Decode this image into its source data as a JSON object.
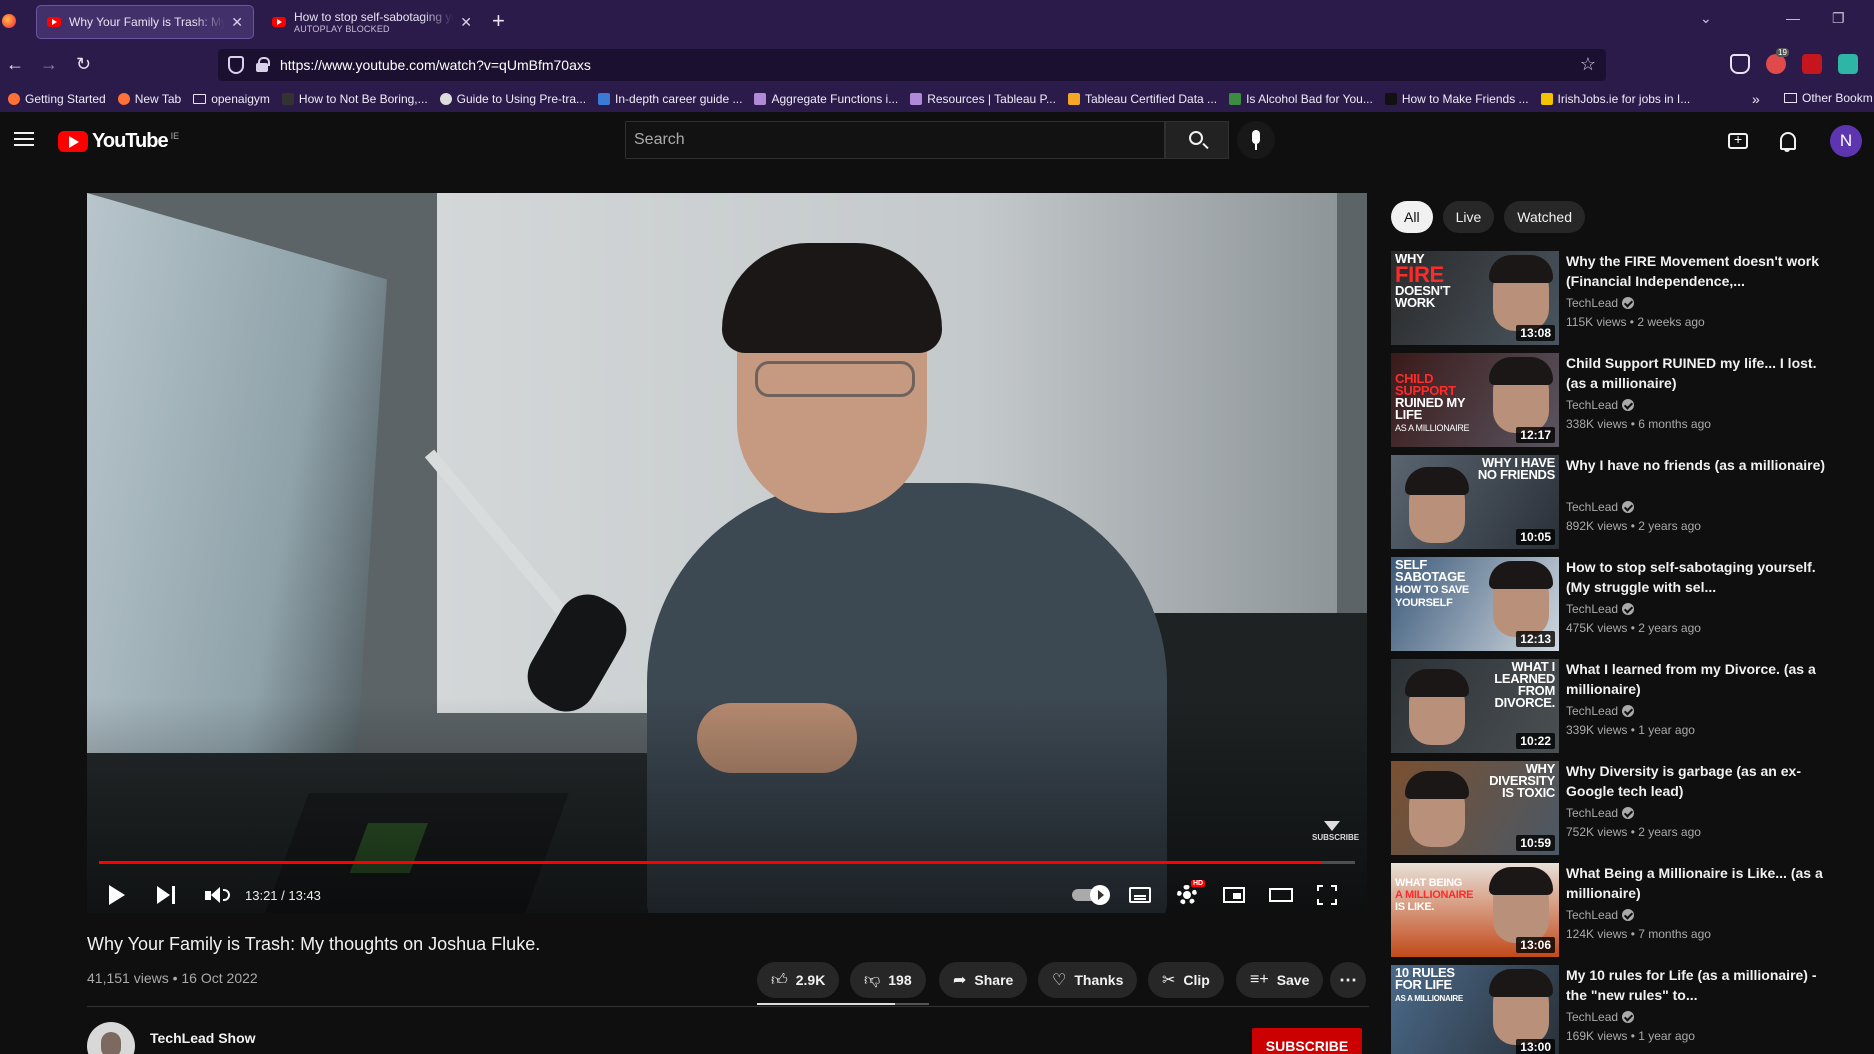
{
  "browser": {
    "tabs": [
      {
        "title": "Why Your Family is Trash: My th",
        "active": true
      },
      {
        "title": "How to stop self-sabotaging yo",
        "subtitle": "AUTOPLAY BLOCKED",
        "active": false
      }
    ],
    "url": "https://www.youtube.com/watch?v=qUmBfm70axs",
    "ext_badge": "19",
    "bookmarks": [
      "Getting Started",
      "New Tab",
      "openaigym",
      "How to Not Be Boring,...",
      "Guide to Using Pre-tra...",
      "In-depth career guide ...",
      "Aggregate Functions i...",
      "Resources | Tableau P...",
      "Tableau Certified Data ...",
      "Is Alcohol Bad for You...",
      "How to Make Friends ...",
      "IrishJobs.ie for jobs in I..."
    ],
    "bookmarks_more": "»",
    "other_bookmarks": "Other Bookm"
  },
  "youtube": {
    "logo_text": "YouTube",
    "country_code": "IE",
    "search_placeholder": "Search",
    "avatar_letter": "N"
  },
  "player": {
    "time": "13:21 / 13:43",
    "progress": 0.973,
    "watermark": "SUBSCRIBE",
    "hd_badge": "HD"
  },
  "video": {
    "title": "Why Your Family is Trash: My thoughts on Joshua Fluke.",
    "meta": "41,151 views • 16 Oct 2022",
    "likes": "2.9K",
    "dislikes": "198",
    "share": "Share",
    "thanks": "Thanks",
    "clip": "Clip",
    "save": "Save",
    "channel": "TechLead Show",
    "subscribe": "SUBSCRIBE"
  },
  "sidebar": {
    "chips": [
      "All",
      "Live",
      "Watched"
    ],
    "recommendations": [
      {
        "title": "Why the FIRE Movement doesn't work (Financial Independence,...",
        "channel": "TechLead",
        "stats": "115K views • 2 weeks ago",
        "duration": "13:08",
        "thumb_text": [
          "WHY",
          "FIRE",
          "DOESN'T WORK"
        ]
      },
      {
        "title": "Child Support RUINED my life... I lost. (as a millionaire)",
        "channel": "TechLead",
        "stats": "338K views • 6 months ago",
        "duration": "12:17",
        "thumb_text": [
          "CHILD SUPPORT",
          "RUINED MY LIFE",
          "AS A MILLIONAIRE"
        ]
      },
      {
        "title": "Why I have no friends (as a millionaire)",
        "channel": "TechLead",
        "stats": "892K views • 2 years ago",
        "duration": "10:05",
        "thumb_text": [
          "WHY I HAVE",
          "NO FRIENDS",
          ""
        ]
      },
      {
        "title": "How to stop self-sabotaging yourself. (My struggle with sel...",
        "channel": "TechLead",
        "stats": "475K views • 2 years ago",
        "duration": "12:13",
        "thumb_text": [
          "SELF SABOTAGE",
          "HOW TO SAVE YOURSELF",
          ""
        ]
      },
      {
        "title": "What I learned from my Divorce. (as a millionaire)",
        "channel": "TechLead",
        "stats": "339K views • 1 year ago",
        "duration": "10:22",
        "thumb_text": [
          "WHAT I",
          "LEARNED FROM",
          "DIVORCE."
        ]
      },
      {
        "title": "Why Diversity is garbage (as an ex-Google tech lead)",
        "channel": "TechLead",
        "stats": "752K views • 2 years ago",
        "duration": "10:59",
        "thumb_text": [
          "WHY",
          "DIVERSITY",
          "IS TOXIC"
        ]
      },
      {
        "title": "What Being a Millionaire is Like... (as a millionaire)",
        "channel": "TechLead",
        "stats": "124K views • 7 months ago",
        "duration": "13:06",
        "thumb_text": [
          "WHAT BEING",
          "A MILLIONAIRE",
          "IS LIKE."
        ]
      },
      {
        "title": "My 10 rules for Life (as a millionaire) - the \"new rules\" to...",
        "channel": "TechLead",
        "stats": "169K views • 1 year ago",
        "duration": "13:00",
        "thumb_text": [
          "10 RULES",
          "FOR LIFE",
          "AS A MILLIONAIRE"
        ]
      }
    ]
  },
  "colors": {
    "browser_chrome": "#2b1b4a",
    "yt_background": "#0f0f0f",
    "accent_red": "#ff0000",
    "subscribe_red": "#cc0000"
  }
}
